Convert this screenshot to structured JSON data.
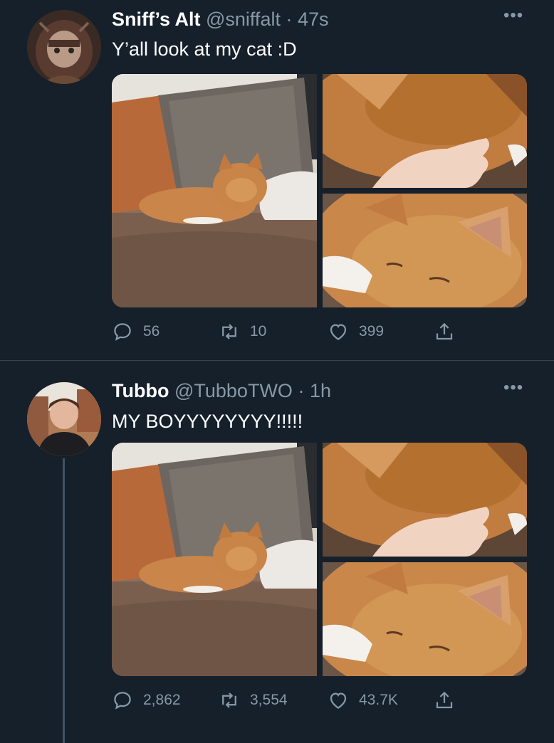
{
  "tweets": [
    {
      "display_name": "Sniff’s Alt",
      "handle": "@sniffalt",
      "separator": "·",
      "time": "47s",
      "text": "Y’all look at my cat :D",
      "replies": "56",
      "retweets": "10",
      "likes": "399"
    },
    {
      "display_name": "Tubbo",
      "handle": "@TubboTWO",
      "separator": "·",
      "time": "1h",
      "text": "MY BOYYYYYYYY!!!!!",
      "replies": "2,862",
      "retweets": "3,554",
      "likes": "43.7K"
    }
  ],
  "icons": {
    "more": "more-dots-icon",
    "reply": "reply-bubble-icon",
    "retweet": "retweet-arrows-icon",
    "like": "heart-icon",
    "share": "share-upload-icon"
  },
  "colors": {
    "background": "#15202b",
    "text_primary": "#ffffff",
    "text_secondary": "#8899a6",
    "divider": "#38444d",
    "thread_line": "#3d5466"
  }
}
